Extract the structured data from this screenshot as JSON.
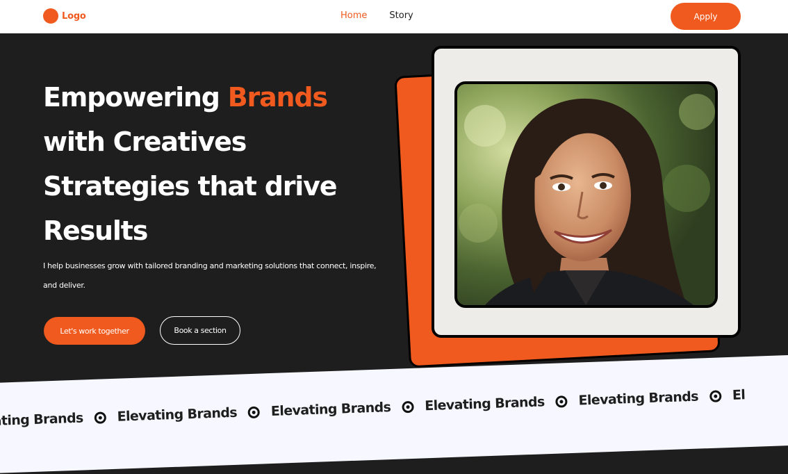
{
  "nav": {
    "logo_text": "Logo",
    "links": [
      {
        "label": "Home",
        "active": true
      },
      {
        "label": "Story",
        "active": false
      }
    ],
    "apply_label": "Apply"
  },
  "hero": {
    "headline_part1": "Empowering ",
    "headline_accent": "Brands",
    "headline_part2": "with Creatives Strategies that drive Results",
    "subtext": "I help businesses grow with tailored branding and marketing solutions that connect, inspire, and deliver.",
    "primary_cta": "Let's work together",
    "secondary_cta": "Book a section"
  },
  "marquee": {
    "items": [
      "vating Brands",
      "Elevating Brands",
      "Elevating Brands",
      "Elevating Brands",
      "Elevating Brands",
      "El"
    ],
    "icon": "circle-dot-icon"
  },
  "colors": {
    "accent": "#f05a1e",
    "dark_bg": "#1e1e1e",
    "frame_bg": "#eeece8",
    "marquee_bg": "#f7f8ff"
  }
}
